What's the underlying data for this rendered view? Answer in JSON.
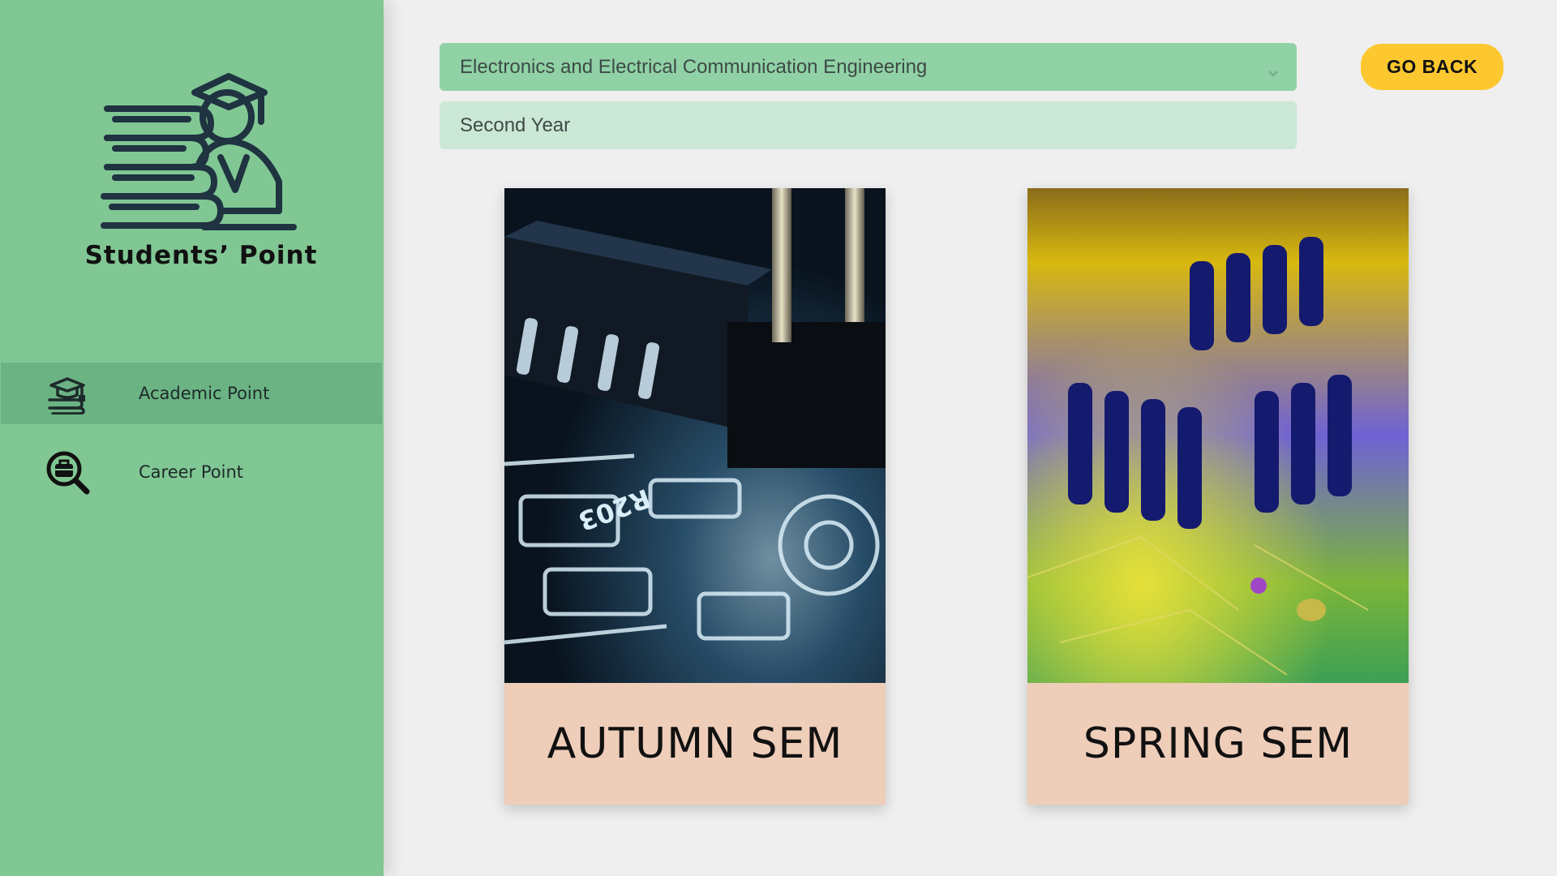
{
  "sidebar": {
    "brand": "Students’ Point",
    "items": [
      {
        "label": "Academic Point",
        "icon": "graduate-books-icon",
        "active": true
      },
      {
        "label": "Career Point",
        "icon": "briefcase-search-icon",
        "active": false
      }
    ]
  },
  "filters": {
    "department": "Electronics and Electrical Communication Engineering",
    "year": "Second Year"
  },
  "actions": {
    "go_back": "GO BACK"
  },
  "cards": [
    {
      "label": "AUTUMN SEM",
      "image": "circuit-board-closeup-photo"
    },
    {
      "label": "SPRING SEM",
      "image": "colorful-chip-socket-photo"
    }
  ],
  "colors": {
    "sidebar": "#80c794",
    "sidebar_active": "#6bb383",
    "select_bg": "#90d2a5",
    "year_bg": "#cbe7d5",
    "button": "#fdc82f",
    "caption_bg": "#eecdb9",
    "page_bg": "#efefef"
  }
}
